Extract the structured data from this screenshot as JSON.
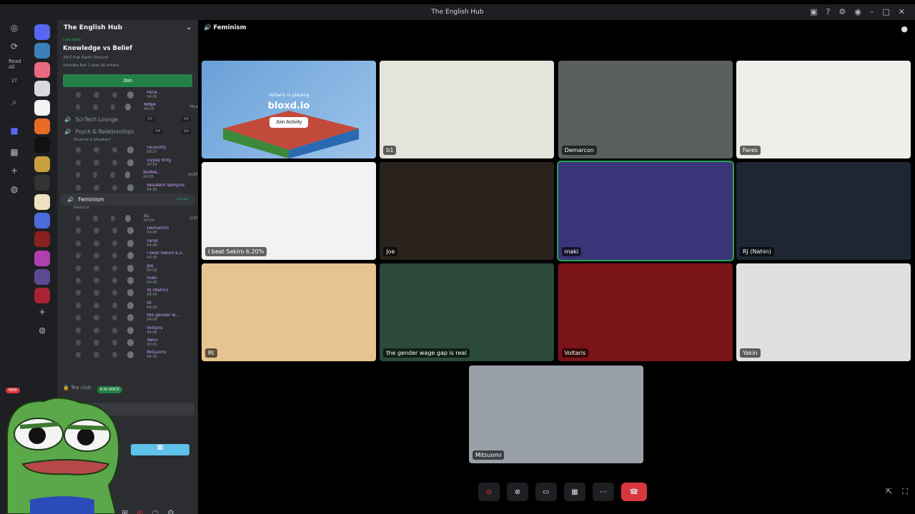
{
  "window": {
    "title": "The English Hub"
  },
  "rail": {
    "read_all": "Read All",
    "badge": "27"
  },
  "server": {
    "name": "The English Hub"
  },
  "live": {
    "label": "Live Now",
    "event_title": "Knowledge vs Belief",
    "subtitle": "24/7 Flat Earth Discord",
    "attendees": "Youtube Bot 2 and 26 others",
    "join_label": "Join"
  },
  "channels": [
    {
      "name": "Sci-Tech Lounge",
      "count_a": "00",
      "count_b": "99"
    },
    {
      "name": "Psych & Relationships",
      "sub": "Divorce a cheater?",
      "count_a": "04",
      "count_b": "99"
    },
    {
      "name": "Feminism",
      "sub": "bloxd.io",
      "timer": "47:44"
    }
  ],
  "top_members": [
    {
      "name": "Parik..",
      "time": "04:05"
    },
    {
      "name": "NINJA",
      "time": "04:05",
      "tag": "Mrre"
    }
  ],
  "psych_members": [
    {
      "name": "Fauxxxty",
      "time": "08:27"
    },
    {
      "name": "Gypsy King",
      "time": "04:05"
    },
    {
      "name": "NotMe...",
      "time": "04:05",
      "tag": "GOAT"
    },
    {
      "name": "Resident Vampire",
      "time": "04:05"
    }
  ],
  "feminism_members": [
    {
      "name": "b1",
      "time": "04:04",
      "tag": "GOD"
    },
    {
      "name": "Demarcon",
      "time": "04:05"
    },
    {
      "name": "Fares",
      "time": "04:48"
    },
    {
      "name": "I beat Sekiro 6.2...",
      "time": "04:05"
    },
    {
      "name": "Joe",
      "time": "00:52"
    },
    {
      "name": "maki",
      "time": "04:05"
    },
    {
      "name": "RJ (Nahin)",
      "time": "04:05"
    },
    {
      "name": "Rt",
      "time": "04:05"
    },
    {
      "name": "the gender w...",
      "time": "04:05"
    },
    {
      "name": "Voltaris",
      "time": "04:05"
    },
    {
      "name": "Yakin",
      "time": "00:01"
    },
    {
      "name": "Mitsuomi",
      "time": "04:05"
    }
  ],
  "tea": {
    "name": "Tea club",
    "in_voice": "8 IN VOICE"
  },
  "new_badge": "NEW",
  "stage": {
    "channel": "Feminism"
  },
  "activity": {
    "playing": "Voltaris is playing",
    "game": "bloxd.io",
    "join_label": "Join Activity"
  },
  "tiles": [
    {
      "label": "b1"
    },
    {
      "label": "Demarcon"
    },
    {
      "label": "Fares"
    },
    {
      "label": "I beat Sekiro 6.20%"
    },
    {
      "label": "Joe"
    },
    {
      "label": "maki"
    },
    {
      "label": "RJ (Nahin)"
    },
    {
      "label": "Rt"
    },
    {
      "label": "the gender wage gap is real"
    },
    {
      "label": "Voltaris"
    },
    {
      "label": "Yakin"
    },
    {
      "label": "Mitsuomi"
    }
  ]
}
